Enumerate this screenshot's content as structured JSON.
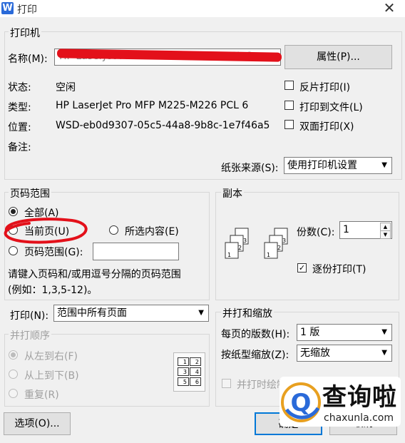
{
  "window": {
    "title": "打印",
    "app_icon": "W"
  },
  "printer": {
    "group_label": "打印机",
    "name_label": "名称(M):",
    "name_value": "HP LaserJet Pro MFP M225-M226 PCL 6",
    "properties_button": "属性(P)...",
    "status_label": "状态:",
    "status_value": "空闲",
    "type_label": "类型:",
    "type_value": "HP LaserJet Pro MFP M225-M226 PCL 6",
    "location_label": "位置:",
    "location_value": "WSD-eb0d9307-05c5-44a8-9b8c-1e7f46a5",
    "comment_label": "备注:",
    "reverse_print": "反片打印(I)",
    "print_to_file": "打印到文件(L)",
    "duplex": "双面打印(X)",
    "paper_source_label": "纸张来源(S):",
    "paper_source_value": "使用打印机设置"
  },
  "page_range": {
    "group_label": "页码范围",
    "all": "全部(A)",
    "current": "当前页(U)",
    "selection": "所选内容(E)",
    "pages": "页码范围(G):",
    "pages_value": "",
    "hint_line1": "请键入页码和/或用逗号分隔的页码范围",
    "hint_line2": "(例如：1,3,5-12)。"
  },
  "copies": {
    "group_label": "副本",
    "count_label": "份数(C):",
    "count_value": "1",
    "collate": "逐份打印(T)",
    "collate_checked": true
  },
  "print_what": {
    "label": "打印(N):",
    "value": "范围中所有页面"
  },
  "order": {
    "group_label": "并打顺序",
    "left_right": "从左到右(F)",
    "top_bottom": "从上到下(B)",
    "repeat": "重复(R)",
    "thumb_pages": [
      "1",
      "2",
      "3",
      "4",
      "5",
      "6"
    ]
  },
  "zoom": {
    "group_label": "并打和缩放",
    "pages_per_sheet_label": "每页的版数(H):",
    "pages_per_sheet_value": "1 版",
    "scale_label": "按纸型缩放(Z):",
    "scale_value": "无缩放",
    "draw_borders": "并打时绘制分隔线(D)"
  },
  "footer": {
    "options_button": "选项(O)...",
    "ok_button": "确定",
    "cancel_button": "取消"
  },
  "watermark": {
    "text": "查询啦",
    "subtext": "chaxunla.com",
    "letter": "Q"
  },
  "colors": {
    "annotation_red": "#e3101a",
    "brand_blue": "#2a6ad9"
  }
}
